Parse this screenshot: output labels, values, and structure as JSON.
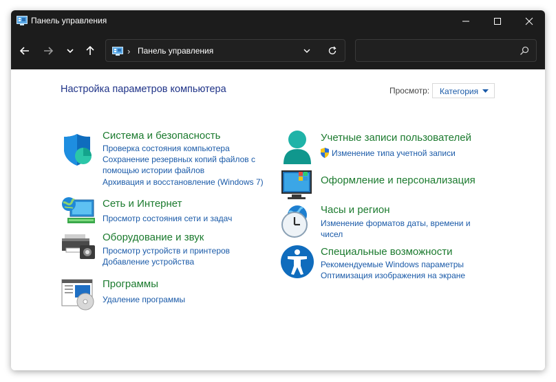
{
  "window": {
    "title": "Панель управления"
  },
  "address_bar": {
    "path": "Панель управления"
  },
  "search": {
    "placeholder": ""
  },
  "header": {
    "title": "Настройка параметров компьютера",
    "view_label": "Просмотр:",
    "view_value": "Категория"
  },
  "categories": {
    "system": {
      "title": "Система и безопасность",
      "links": [
        "Проверка состояния компьютера",
        "Сохранение резервных копий файлов с",
        "помощью истории файлов",
        "Архивация и восстановление (Windows 7)"
      ]
    },
    "network": {
      "title": "Сеть и Интернет",
      "links": [
        "Просмотр состояния сети и задач"
      ]
    },
    "hardware": {
      "title": "Оборудование и звук",
      "links": [
        "Просмотр устройств и принтеров",
        "Добавление устройства"
      ]
    },
    "programs": {
      "title": "Программы",
      "links": [
        "Удаление программы"
      ]
    },
    "accounts": {
      "title": "Учетные записи пользователей",
      "links": [
        "Изменение типа учетной записи"
      ]
    },
    "appearance": {
      "title": "Оформление и персонализация",
      "links": []
    },
    "clock": {
      "title": "Часы и регион",
      "links": [
        "Изменение форматов даты, времени и",
        "чисел"
      ]
    },
    "access": {
      "title": "Специальные возможности",
      "links": [
        "Рекомендуемые Windows параметры",
        "Оптимизация изображения на экране"
      ]
    }
  },
  "colors": {
    "titlebar_bg": "#1c1c1c",
    "category_title": "#1b7a2e",
    "link": "#1a5aa8",
    "page_title": "#1e3287"
  }
}
